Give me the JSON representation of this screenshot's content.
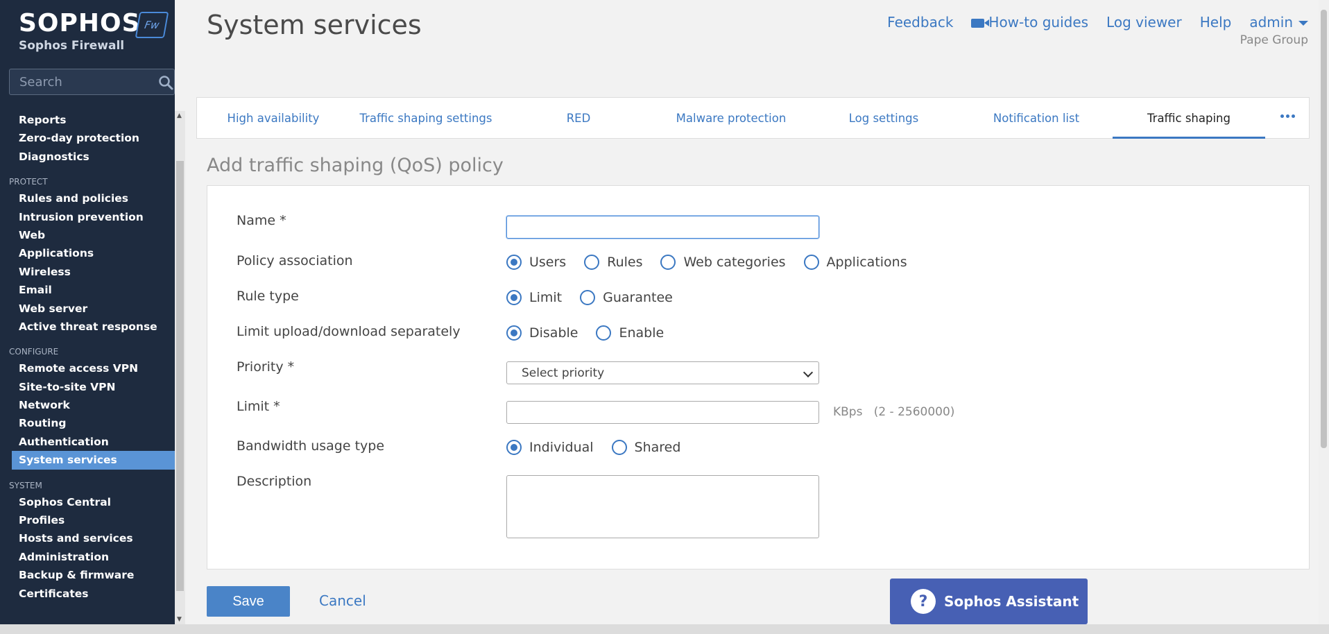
{
  "brand": {
    "name": "SOPHOS",
    "product": "Sophos Firewall",
    "badge": "Fw"
  },
  "search": {
    "placeholder": "Search"
  },
  "nav": {
    "top_items": [
      "Reports",
      "Zero-day protection",
      "Diagnostics"
    ],
    "groups": [
      {
        "label": "PROTECT",
        "items": [
          "Rules and policies",
          "Intrusion prevention",
          "Web",
          "Applications",
          "Wireless",
          "Email",
          "Web server",
          "Active threat response"
        ]
      },
      {
        "label": "CONFIGURE",
        "items": [
          "Remote access VPN",
          "Site-to-site VPN",
          "Network",
          "Routing",
          "Authentication",
          "System services"
        ]
      },
      {
        "label": "SYSTEM",
        "items": [
          "Sophos Central",
          "Profiles",
          "Hosts and services",
          "Administration",
          "Backup & firmware",
          "Certificates"
        ]
      }
    ],
    "active": "System services"
  },
  "header": {
    "title": "System services",
    "links": [
      "Feedback",
      "How-to guides",
      "Log viewer",
      "Help",
      "admin"
    ],
    "org": "Pape Group"
  },
  "tabs": [
    "High availability",
    "Traffic shaping settings",
    "RED",
    "Malware protection",
    "Log settings",
    "Notification list",
    "Traffic shaping"
  ],
  "active_tab": "Traffic shaping",
  "form": {
    "title": "Add traffic shaping (QoS) policy",
    "name": {
      "label": "Name *",
      "value": ""
    },
    "policy_association": {
      "label": "Policy association",
      "options": [
        "Users",
        "Rules",
        "Web categories",
        "Applications"
      ],
      "selected": "Users"
    },
    "rule_type": {
      "label": "Rule type",
      "options": [
        "Limit",
        "Guarantee"
      ],
      "selected": "Limit"
    },
    "limit_separately": {
      "label": "Limit upload/download separately",
      "options": [
        "Disable",
        "Enable"
      ],
      "selected": "Disable"
    },
    "priority": {
      "label": "Priority *",
      "value": "Select priority"
    },
    "limit": {
      "label": "Limit *",
      "value": "",
      "unit": "KBps",
      "range": "(2 - 2560000)"
    },
    "bandwidth_usage": {
      "label": "Bandwidth usage type",
      "options": [
        "Individual",
        "Shared"
      ],
      "selected": "Individual"
    },
    "description": {
      "label": "Description",
      "value": ""
    }
  },
  "footer": {
    "save": "Save",
    "cancel": "Cancel",
    "assistant": "Sophos Assistant"
  }
}
